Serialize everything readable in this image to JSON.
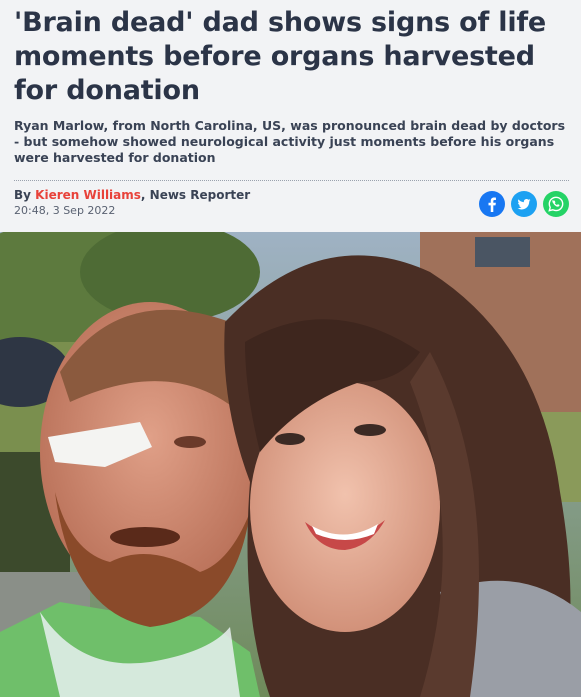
{
  "article": {
    "headline": "'Brain dead' dad shows signs of life moments before organs harvested for donation",
    "standfirst": "Ryan Marlow, from North Carolina, US, was pronounced brain dead by doctors - but somehow showed neurological activity just moments before his organs were harvested for donation",
    "byline_prefix": "By ",
    "author": "Kieren Williams",
    "role": ", News Reporter",
    "timestamp": "20:48, 3 Sep 2022"
  },
  "share": {
    "icons": [
      "facebook-icon",
      "twitter-icon",
      "whatsapp-icon"
    ],
    "colors": {
      "facebook": "#1877f2",
      "twitter": "#1da1f2",
      "whatsapp": "#25d366"
    }
  },
  "colors": {
    "accent": "#e8423a",
    "background": "#f2f3f5",
    "text": "#2b3447"
  }
}
